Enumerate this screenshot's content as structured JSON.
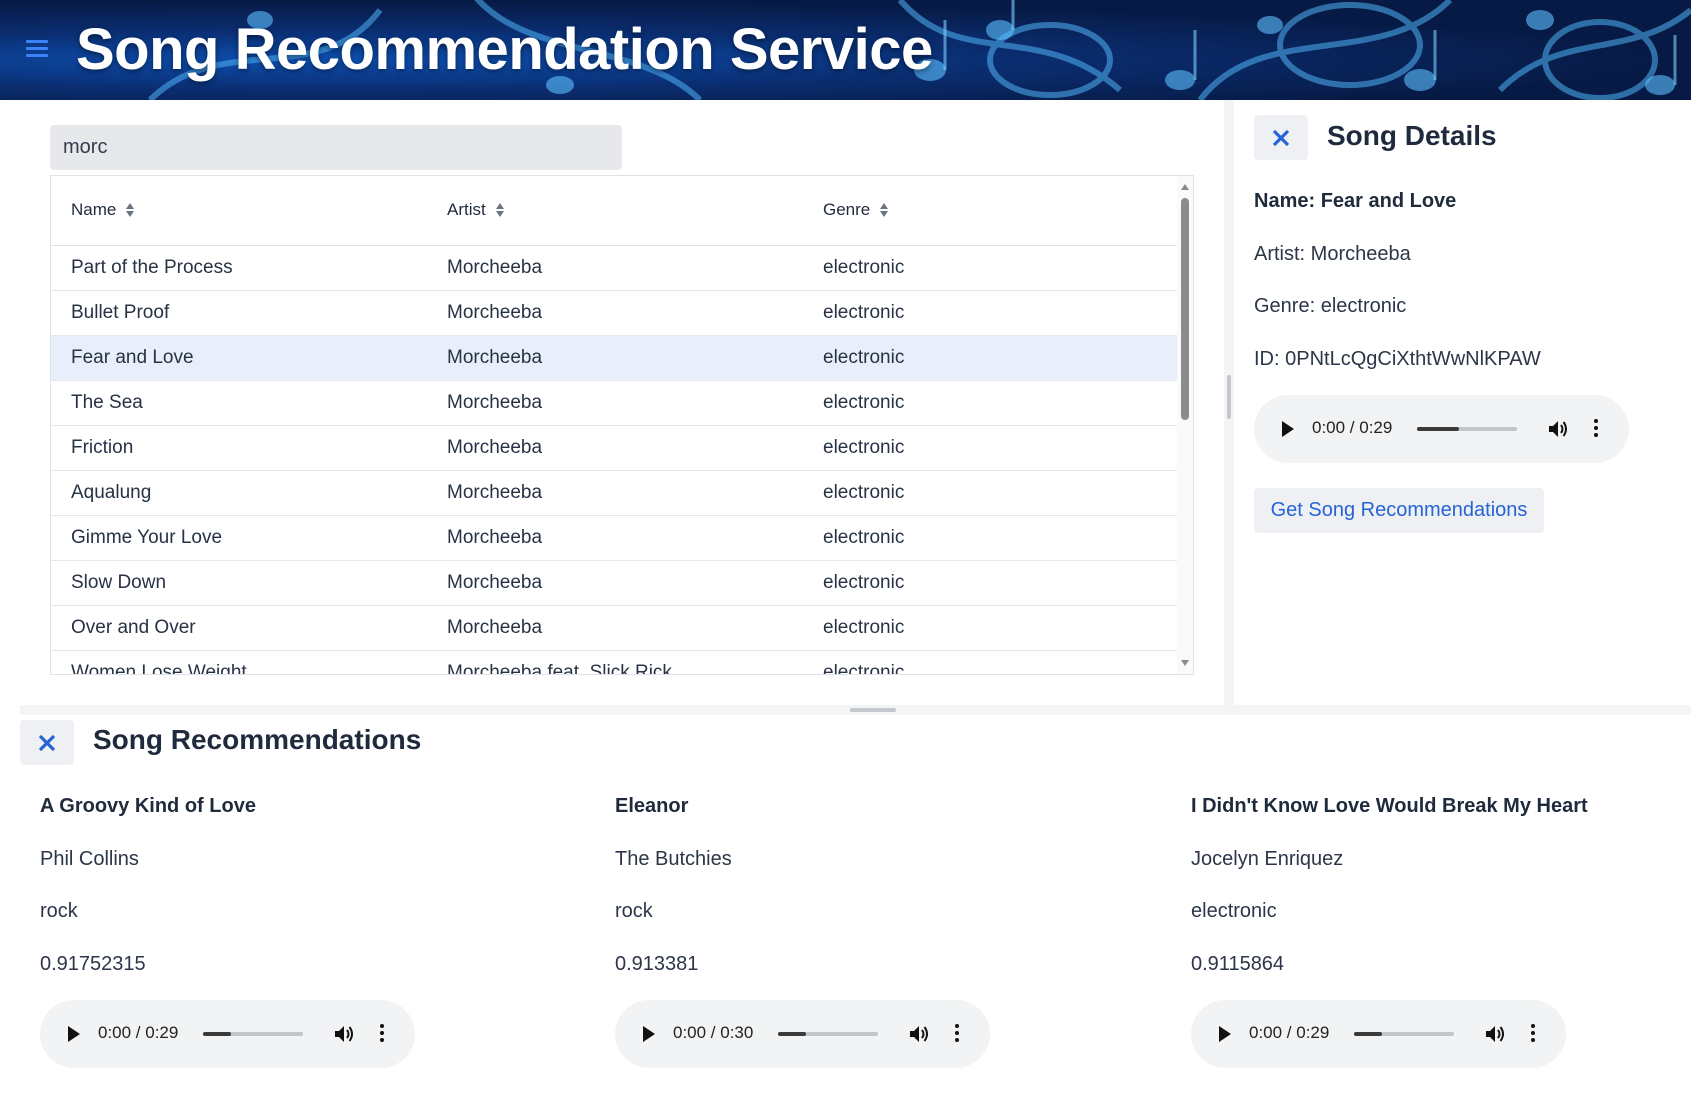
{
  "header": {
    "title": "Song Recommendation Service",
    "menu_icon": "hamburger-menu-icon",
    "accent": "#3b82f6"
  },
  "search": {
    "value": "morc",
    "placeholder": ""
  },
  "table": {
    "columns": [
      "Name",
      "Artist",
      "Genre"
    ],
    "selected_row": 2,
    "rows": [
      {
        "name": "Part of the Process",
        "artist": "Morcheeba",
        "genre": "electronic"
      },
      {
        "name": "Bullet Proof",
        "artist": "Morcheeba",
        "genre": "electronic"
      },
      {
        "name": "Fear and Love",
        "artist": "Morcheeba",
        "genre": "electronic"
      },
      {
        "name": "The Sea",
        "artist": "Morcheeba",
        "genre": "electronic"
      },
      {
        "name": "Friction",
        "artist": "Morcheeba",
        "genre": "electronic"
      },
      {
        "name": "Aqualung",
        "artist": "Morcheeba",
        "genre": "electronic"
      },
      {
        "name": "Gimme Your Love",
        "artist": "Morcheeba",
        "genre": "electronic"
      },
      {
        "name": "Slow Down",
        "artist": "Morcheeba",
        "genre": "electronic"
      },
      {
        "name": "Over and Over",
        "artist": "Morcheeba",
        "genre": "electronic"
      },
      {
        "name": "Women Lose Weight",
        "artist": "Morcheeba feat. Slick Rick",
        "genre": "electronic"
      }
    ]
  },
  "details": {
    "title": "Song Details",
    "name": "Name: Fear and Love",
    "artist": "Artist: Morcheeba",
    "genre": "Genre: electronic",
    "id": "ID: 0PNtLcQgCiXthtWwNlKPAW",
    "audio_time": "0:00 / 0:29",
    "audio_progress": 0.42,
    "button_label": "Get Song Recommendations"
  },
  "recommendations": {
    "title": "Song Recommendations",
    "items": [
      {
        "name": "A Groovy Kind of Love",
        "artist": "Phil Collins",
        "genre": "rock",
        "score": "0.91752315",
        "audio_time": "0:00 / 0:29",
        "audio_progress": 0.28
      },
      {
        "name": "Eleanor",
        "artist": "The Butchies",
        "genre": "rock",
        "score": "0.913381",
        "audio_time": "0:00 / 0:30",
        "audio_progress": 0.28
      },
      {
        "name": "I Didn't Know Love Would Break My Heart",
        "artist": "Jocelyn Enriquez",
        "genre": "electronic",
        "score": "0.9115864",
        "audio_time": "0:00 / 0:29",
        "audio_progress": 0.28
      }
    ]
  }
}
